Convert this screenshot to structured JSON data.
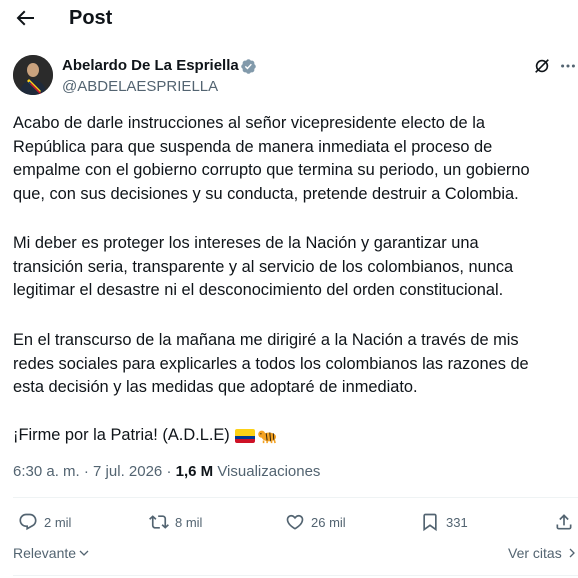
{
  "header": {
    "title": "Post",
    "back_icon": "arrow-left-icon"
  },
  "author": {
    "name": "Abelardo De La Espriella",
    "handle": "@ABDELAESPRIELLA",
    "verified": true,
    "verified_color": "#829aab"
  },
  "post": {
    "paragraph1": [
      "Acabo de darle instrucciones al señor vicepresidente electo de la",
      "República para que suspenda de manera inmediata el proceso de",
      "empalme con el gobierno corrupto que termina su periodo, un gobierno",
      "que, con sus decisiones y su conducta, pretende destruir a Colombia."
    ],
    "paragraph2": [
      "Mi deber es proteger los intereses de la Nación y garantizar una",
      "transición seria, transparente y al servicio de los colombianos, nunca",
      "legitimar el desastre ni el desconocimiento del orden constitucional."
    ],
    "paragraph3": [
      "En el transcurso de la mañana me dirigiré a la Nación a través de mis",
      "redes sociales para explicarles a todos los colombianos las razones de",
      "esta decisión y las medidas que adoptaré de inmediato."
    ],
    "paragraph4": "¡Firme por la Patria! (A.D.L.E)",
    "emojis": [
      "colombia-flag-icon",
      "tiger-icon"
    ]
  },
  "meta": {
    "time": "6:30 a. m.",
    "separator": " · ",
    "date": "7 jul. 2026",
    "views_count": "1,6 M",
    "views_label": "Visualizaciones"
  },
  "actions": {
    "replies": "2 mil",
    "reposts": "8 mil",
    "likes": "26 mil",
    "bookmarks": "331"
  },
  "footer": {
    "sort_label": "Relevante",
    "quotes_label": "Ver citas"
  },
  "colors": {
    "text": "#0f1419",
    "secondary": "#536471",
    "divider": "#eff3f4"
  }
}
